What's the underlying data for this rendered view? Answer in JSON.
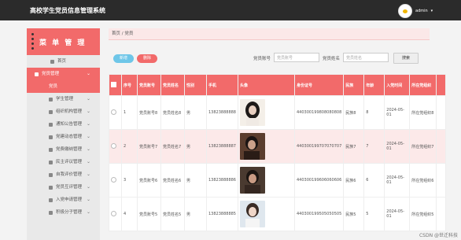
{
  "app": {
    "title": "高校学生党员信息管理系统"
  },
  "user": {
    "name": "admin",
    "caret": "▾"
  },
  "sidebar": {
    "header": "菜 单 管 理",
    "home": "首页",
    "group": "党员管理",
    "active_sub": "党员",
    "items": [
      {
        "label": "学生管理"
      },
      {
        "label": "组织机构管理"
      },
      {
        "label": "通知公告管理"
      },
      {
        "label": "党建动态管理"
      },
      {
        "label": "党费缴纳管理"
      },
      {
        "label": "民主评议管理"
      },
      {
        "label": "自我评价管理"
      },
      {
        "label": "党员互评管理"
      },
      {
        "label": "入党申请管理"
      },
      {
        "label": "积极分子管理"
      }
    ]
  },
  "breadcrumb": {
    "home": "首页",
    "sep": "/",
    "current": "党员"
  },
  "toolbar": {
    "add": "新增",
    "delete": "删除",
    "field1_label": "党员账号",
    "field1_placeholder": "党员账号",
    "field2_label": "党员姓名",
    "field2_placeholder": "党员姓名",
    "search": "搜索"
  },
  "table": {
    "columns": [
      "序号",
      "党员账号",
      "党员姓名",
      "性别",
      "手机",
      "头像",
      "身份证号",
      "民族",
      "年龄",
      "入党时间",
      "所在党组织"
    ],
    "rows": [
      {
        "no": "1",
        "account": "党员账号8",
        "name": "党员姓名8",
        "gender": "男",
        "phone": "13823888888",
        "id": "440300199808080808",
        "nation": "民族8",
        "age": "8",
        "date": "2024-05-01",
        "org": "所在党组织8"
      },
      {
        "no": "2",
        "account": "党员账号7",
        "name": "党员姓名7",
        "gender": "男",
        "phone": "13823888887",
        "id": "440300199707070707",
        "nation": "民族7",
        "age": "7",
        "date": "2024-05-01",
        "org": "所在党组织7"
      },
      {
        "no": "3",
        "account": "党员账号6",
        "name": "党员姓名6",
        "gender": "男",
        "phone": "13823888886",
        "id": "440300199606060606",
        "nation": "民族6",
        "age": "6",
        "date": "2024-05-01",
        "org": "所在党组织6"
      },
      {
        "no": "4",
        "account": "党员账号5",
        "name": "党员姓名5",
        "gender": "男",
        "phone": "13823888885",
        "id": "440300199505050505",
        "nation": "民族5",
        "age": "5",
        "date": "2024-05-01",
        "org": "所在党组织5"
      }
    ]
  },
  "watermark": "CSDN @世迁科技",
  "colors": {
    "accent": "#f26a6a",
    "topbar": "#2b2b2b",
    "add": "#6ec6e8"
  }
}
